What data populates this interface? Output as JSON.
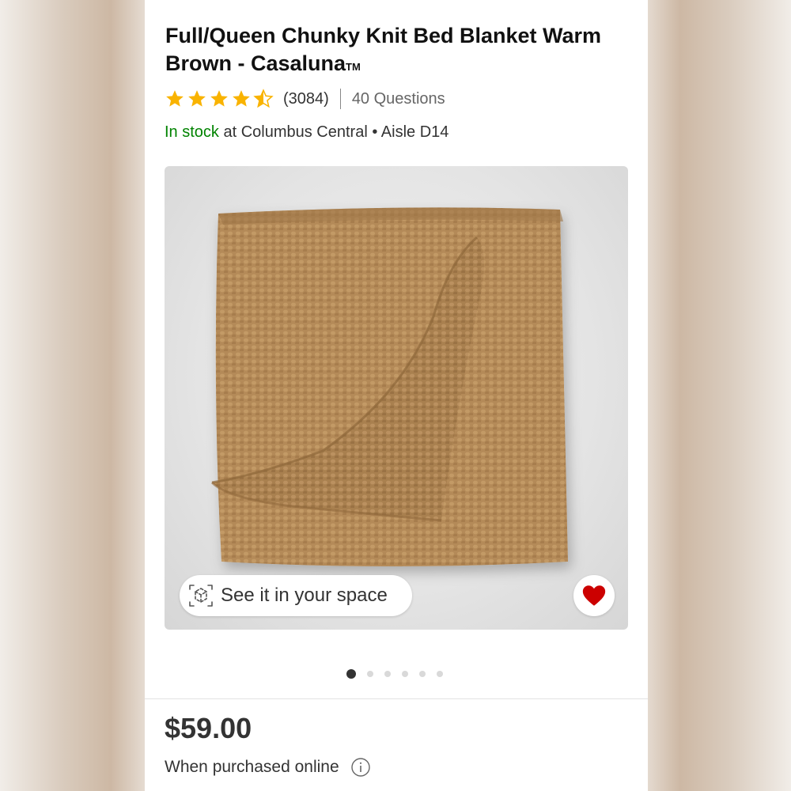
{
  "product": {
    "title_main": "Full/Queen Chunky Knit Bed Blanket Warm Brown - Casaluna",
    "title_tm": "TM",
    "rating_value": 4.5,
    "review_count": "(3084)",
    "questions": "40 Questions"
  },
  "stock": {
    "status": "In stock",
    "location": " at Columbus Central • Aisle D14"
  },
  "gallery": {
    "see_space_label": "See it in your space",
    "image_count": 6,
    "active_index": 0
  },
  "pricing": {
    "price": "$59.00",
    "purchase_note": "When purchased online"
  },
  "colors": {
    "in_stock": "#008300",
    "star": "#f9b300",
    "heart": "#cc0000",
    "blanket": "#b48a58"
  },
  "icons": [
    "star-icon",
    "ar-cube-icon",
    "heart-icon",
    "info-icon"
  ]
}
